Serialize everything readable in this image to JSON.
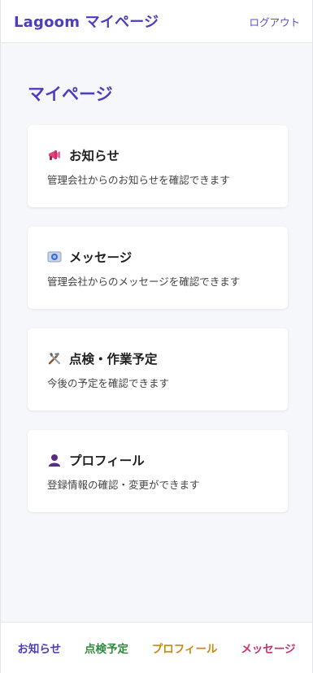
{
  "header": {
    "title": "Lagoom マイページ",
    "logout_label": "ログアウト"
  },
  "page_title": "マイページ",
  "cards": [
    {
      "icon": "megaphone-icon",
      "title": "お知らせ",
      "description": "管理会社からのお知らせを確認できます"
    },
    {
      "icon": "message-icon",
      "title": "メッセージ",
      "description": "管理会社からのメッセージを確認できます"
    },
    {
      "icon": "tools-icon",
      "title": "点検・作業予定",
      "description": "今後の予定を確認できます"
    },
    {
      "icon": "user-icon",
      "title": "プロフィール",
      "description": "登録情報の確認・変更ができます"
    }
  ],
  "tabs": [
    {
      "label": "お知らせ",
      "color": "#4b3fc0"
    },
    {
      "label": "点検予定",
      "color": "#2e8b3e"
    },
    {
      "label": "プロフィール",
      "color": "#c98a10"
    },
    {
      "label": "メッセージ",
      "color": "#c8336e"
    }
  ],
  "colors": {
    "accent": "#4b3fc0"
  }
}
